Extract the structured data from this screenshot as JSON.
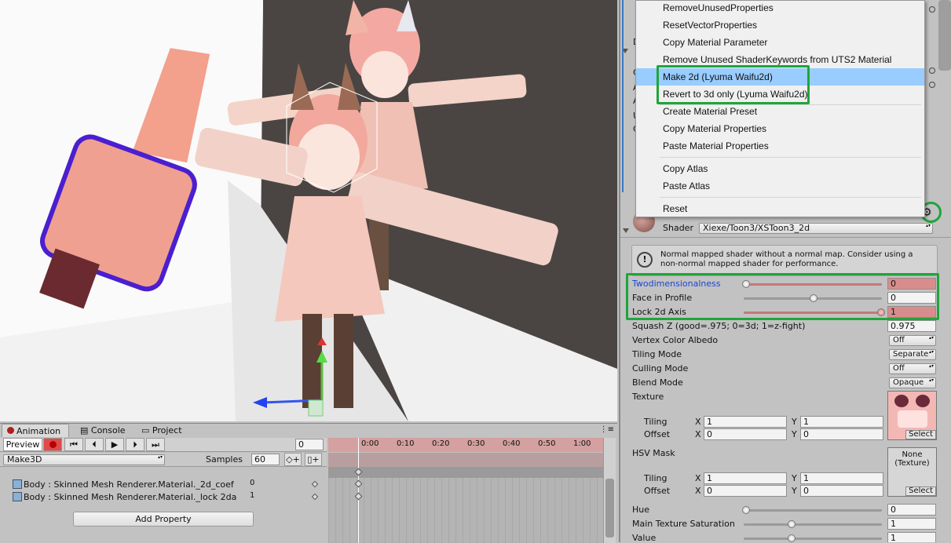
{
  "context_menu": {
    "items": [
      {
        "label": "RemoveUnusedProperties"
      },
      {
        "label": "ResetVectorProperties"
      },
      {
        "label": "Copy Material Parameter"
      },
      {
        "label": "Remove Unused ShaderKeywords from UTS2 Material"
      },
      {
        "label": "Make 2d (Lyuma Waifu2d)"
      },
      {
        "label": "Revert to 3d only (Lyuma Waifu2d)"
      },
      {
        "label": "Create Material Preset"
      },
      {
        "label": "Copy Material Properties"
      },
      {
        "label": "Paste Material Properties"
      },
      {
        "label": "Copy Atlas"
      },
      {
        "label": "Paste Atlas"
      },
      {
        "label": "Reset"
      }
    ]
  },
  "inspector": {
    "shader_label": "Shader",
    "shader_value": "Xiexe/Toon3/XSToon3_2d",
    "help_text_1": "Normal mapped shader without a normal map. Consider using a",
    "help_text_2": "non-normal mapped shader for performance.",
    "twodim_label": "Twodimensionalness",
    "twodim_value": "0",
    "face_label": "Face in Profile",
    "face_value": "0",
    "lock_label": "Lock 2d Axis",
    "lock_value": "1",
    "squash_label": "Squash Z (good=.975; 0=3d; 1=z-fight)",
    "squash_value": "0.975",
    "vca_label": "Vertex Color Albedo",
    "vca_value": "Off",
    "tiling_mode_label": "Tiling Mode",
    "tiling_mode_value": "Separate",
    "culling_label": "Culling Mode",
    "culling_value": "Off",
    "blend_label": "Blend Mode",
    "blend_value": "Opaque",
    "texture_label": "Texture",
    "tiling_label": "Tiling",
    "offset_label": "Offset",
    "x_label": "X",
    "y_label": "Y",
    "tex_tiling_x": "1",
    "tex_tiling_y": "1",
    "tex_offset_x": "0",
    "tex_offset_y": "0",
    "select_label": "Select",
    "hsv_label": "HSV Mask",
    "hsv_none": "None",
    "hsv_texture": "(Texture)",
    "hsv_tiling_x": "1",
    "hsv_tiling_y": "1",
    "hsv_offset_x": "0",
    "hsv_offset_y": "0",
    "hue_label": "Hue",
    "hue_value": "0",
    "sat_label": "Main Texture Saturation",
    "sat_value": "1",
    "value_label": "Value",
    "value_value": "1",
    "partial_letters": [
      "D",
      "C",
      "A",
      "A",
      "U",
      "C"
    ]
  },
  "animation": {
    "tabs": [
      {
        "label": "Animation"
      },
      {
        "label": "Console"
      },
      {
        "label": "Project"
      }
    ],
    "preview_label": "Preview",
    "frame_value": "0",
    "clip_name": "Make3D",
    "samples_label": "Samples",
    "samples_value": "60",
    "timeline_ticks": [
      "0:00",
      "0:10",
      "0:20",
      "0:30",
      "0:40",
      "0:50",
      "1:00"
    ],
    "tracks": [
      {
        "name": "Body : Skinned Mesh Renderer.Material._2d_coef",
        "value": "0"
      },
      {
        "name": "Body : Skinned Mesh Renderer.Material._lock 2da",
        "value": "1"
      }
    ],
    "add_property_label": "Add Property"
  },
  "colors": {
    "highlight": "#99ccff",
    "green_annotation": "#1fa53a",
    "field_red": "#d98c8c",
    "timeline_header": "#d4a0a0"
  }
}
